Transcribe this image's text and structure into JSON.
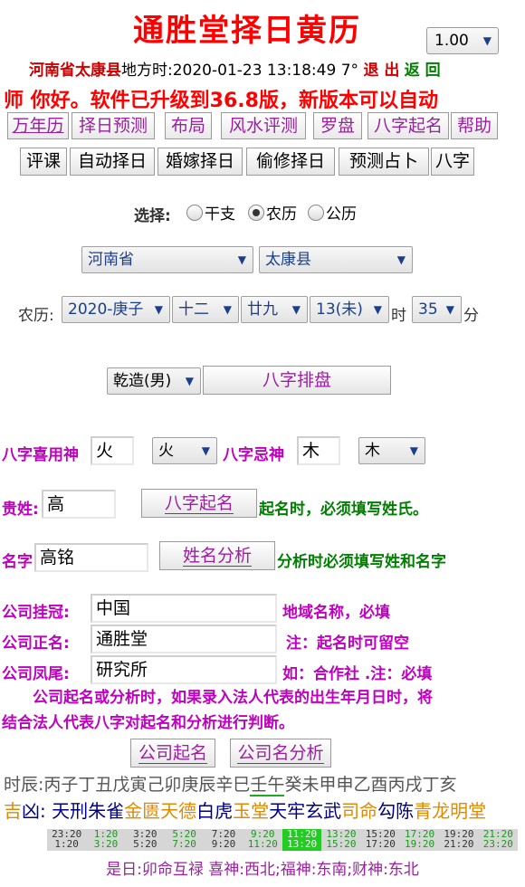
{
  "app_title": "通胜堂择日黄历",
  "version": "1.00",
  "location_line": {
    "place": "河南省太康县",
    "local_time_label": "地方时:",
    "local_time": "2020-01-23 13:18:49",
    "temperature": "7°",
    "exit_label": "退 出",
    "back_label": "返 回"
  },
  "marquee": "师 你好。软件已升级到36.8版，新版本可以自动",
  "top_tabs": [
    "万年历",
    "择日预测",
    "布局",
    "风水评测",
    "罗盘",
    "八字起名",
    "帮助"
  ],
  "second_tabs": [
    "评课",
    "自动择日",
    "婚嫁择日",
    "偷修择日",
    "预测占卜",
    "八字"
  ],
  "calendar_choice": {
    "label": "选择:",
    "options": [
      "干支",
      "农历",
      "公历"
    ],
    "selected": "农历"
  },
  "province": "河南省",
  "county": "太康县",
  "lunar": {
    "label": "农历:",
    "year": "2020-庚子",
    "month": "十二",
    "day": "廿九",
    "hour": "13(未)",
    "hour_unit": "时",
    "minute": "35",
    "minute_unit": "分"
  },
  "gender_select": "乾造(男)",
  "bazi_paipan_button": "八字排盘",
  "xiyong": {
    "label": "八字喜用神",
    "value": "火",
    "select": "火",
    "ji_label": "八字忌神",
    "ji_value": "木",
    "ji_select": "木"
  },
  "surname": {
    "label": "贵姓:",
    "value": "高",
    "button": "八字起名",
    "hint": "起名时，必须填写姓氏。"
  },
  "fullname": {
    "label": "名字",
    "value": "高铭",
    "button": "姓名分析",
    "hint": "分析时必须填写姓和名字"
  },
  "company": {
    "prefix_label": "公司挂冠:",
    "prefix_value": "中国",
    "prefix_hint": "地域名称，必填",
    "name_label": "公司正名:",
    "name_value": "通胜堂",
    "name_hint": "注：起名时可留空",
    "suffix_label": "公司凤尾:",
    "suffix_value": "研究所",
    "suffix_hint": "如：合作社 .注：必填"
  },
  "company_note_1": "公司起名或分析时，如果录入法人代表的出生年月日时，将",
  "company_note_2": "结合法人代表八字对起名和分析进行判断。",
  "company_name_button": "公司起名",
  "company_analysis_button": "公司名分析",
  "hour_branches": {
    "label": "时辰:",
    "before": "丙子丁丑戊寅己卯庚辰辛巳",
    "current": "壬午",
    "after": "癸未甲申乙酉丙戌丁亥"
  },
  "gods": {
    "label_ji": "吉",
    "label_xiong": "凶:",
    "items": [
      {
        "text": "天刑",
        "color": "#000080"
      },
      {
        "text": "朱雀",
        "color": "#000080"
      },
      {
        "text": "金匮",
        "color": "#e08a00"
      },
      {
        "text": "天德",
        "color": "#e08a00"
      },
      {
        "text": "白虎",
        "color": "#000080"
      },
      {
        "text": "玉堂",
        "color": "#e08a00"
      },
      {
        "text": "天牢",
        "color": "#000080"
      },
      {
        "text": "玄武",
        "color": "#000080"
      },
      {
        "text": "司命",
        "color": "#e08a00"
      },
      {
        "text": "勾陈",
        "color": "#000080"
      },
      {
        "text": "青龙",
        "color": "#e08a00"
      },
      {
        "text": "明堂",
        "color": "#e08a00"
      }
    ]
  },
  "time_slots": [
    {
      "top": "23:20",
      "bottom": "1:20",
      "style": "normal"
    },
    {
      "top": "1:20",
      "bottom": "3:20",
      "style": "green"
    },
    {
      "top": "3:20",
      "bottom": "5:20",
      "style": "normal"
    },
    {
      "top": "5:20",
      "bottom": "7:20",
      "style": "green"
    },
    {
      "top": "7:20",
      "bottom": "9:20",
      "style": "normal"
    },
    {
      "top": "9:20",
      "bottom": "11:20",
      "style": "green"
    },
    {
      "top": "11:20",
      "bottom": "13:20",
      "style": "highlight"
    },
    {
      "top": "13:20",
      "bottom": "15:20",
      "style": "green"
    },
    {
      "top": "15:20",
      "bottom": "17:20",
      "style": "normal"
    },
    {
      "top": "17:20",
      "bottom": "19:20",
      "style": "green"
    },
    {
      "top": "19:20",
      "bottom": "21:20",
      "style": "normal"
    },
    {
      "top": "21:20",
      "bottom": "23:20",
      "style": "green"
    }
  ],
  "bottom_line": "是日:卯命互禄 喜神:西北;福神:东南;财神:东北"
}
